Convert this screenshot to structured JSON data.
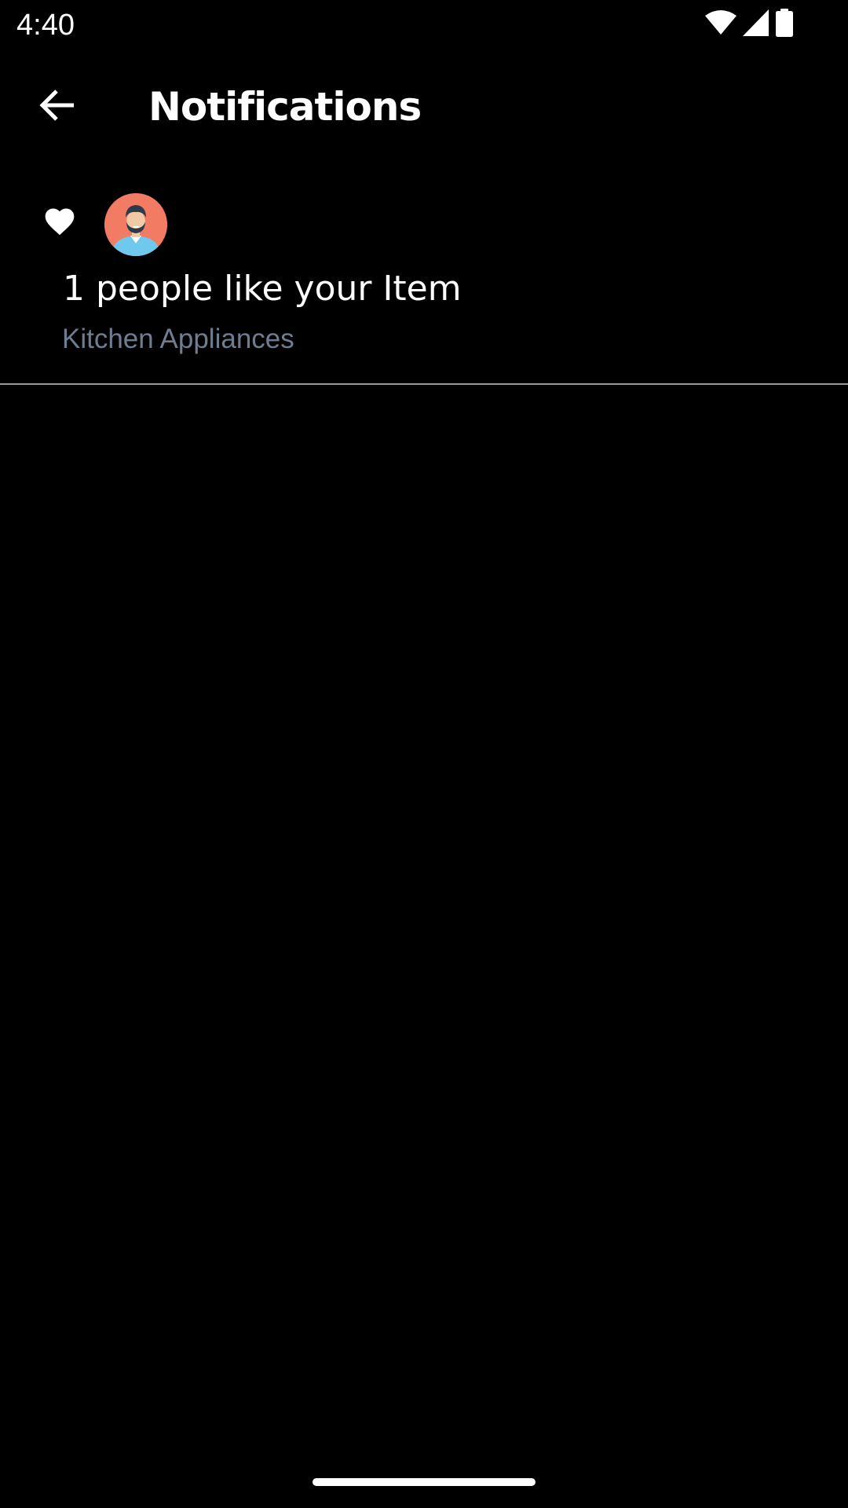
{
  "status_bar": {
    "time": "4:40",
    "icons": [
      "wifi-icon",
      "cellular-signal-icon",
      "battery-icon"
    ]
  },
  "app_bar": {
    "title": "Notifications",
    "back_icon": "arrow-left-icon"
  },
  "notifications": [
    {
      "icon": "heart-icon",
      "avatar": "user-avatar",
      "title": "1 people like your Item",
      "subtitle": "Kitchen Appliances"
    }
  ],
  "colors": {
    "background": "#000000",
    "text_primary": "#ffffff",
    "text_secondary": "#6e7d92",
    "divider": "#9a9a9a",
    "avatar_background": "#f17c63"
  }
}
